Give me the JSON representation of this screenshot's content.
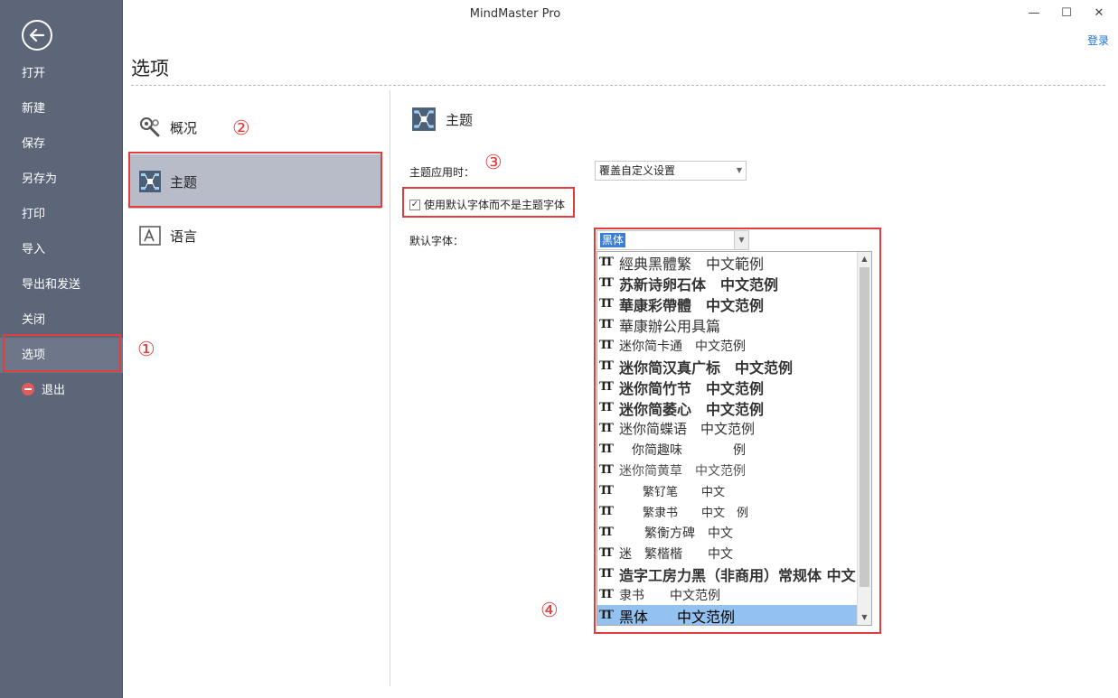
{
  "window": {
    "title": "MindMaster Pro",
    "minimize": "—",
    "maximize": "☐",
    "close": "✕",
    "login": "登录"
  },
  "sidebar": {
    "items": [
      {
        "label": "打开"
      },
      {
        "label": "新建"
      },
      {
        "label": "保存"
      },
      {
        "label": "另存为"
      },
      {
        "label": "打印"
      },
      {
        "label": "导入"
      },
      {
        "label": "导出和发送"
      },
      {
        "label": "关闭"
      },
      {
        "label": "选项"
      },
      {
        "label": "退出"
      }
    ]
  },
  "page": {
    "title": "选项"
  },
  "categories": [
    {
      "label": "概况",
      "icon": "wrench-gear-icon"
    },
    {
      "label": "主题",
      "icon": "theme-icon"
    },
    {
      "label": "语言",
      "icon": "language-icon"
    }
  ],
  "theme_section": {
    "header": "主题",
    "apply_label": "主题应用时：",
    "apply_value": "覆盖自定义设置",
    "checkbox_label": "使用默认字体而不是主题字体",
    "checkbox_checked": true,
    "font_label": "默认字体：",
    "font_value": "黑体"
  },
  "font_options": [
    "經典黑體繁　中文範例",
    "苏新诗卵石体　中文范例",
    "華康彩帶體　中文范例",
    "華康辦公用具篇",
    "迷你简卡通　中文范例",
    "迷你简汉真广标　中文范例",
    "迷你简竹节　中文范例",
    "迷你简萎心　中文范例",
    "迷你简蝶语　中文范例",
    "　你简趣味　　　　例",
    "迷你简黄草　中文范例",
    "　　繁钌笔　　中文",
    "　　繁隶书　　中文　例",
    "　　繁衡方碑　中文",
    "迷　繁楷楷　　中文",
    "造字工房力黑（非商用）常规体 中文",
    "隶书　　中文范例",
    "黑体　　中文范例"
  ],
  "annotations": [
    "①",
    "②",
    "③",
    "④"
  ],
  "colors": {
    "sidebar_bg": "#5d6679",
    "accent_red": "#e23c3c",
    "selection_blue": "#93c2f0",
    "link_blue": "#1f6fd6"
  }
}
